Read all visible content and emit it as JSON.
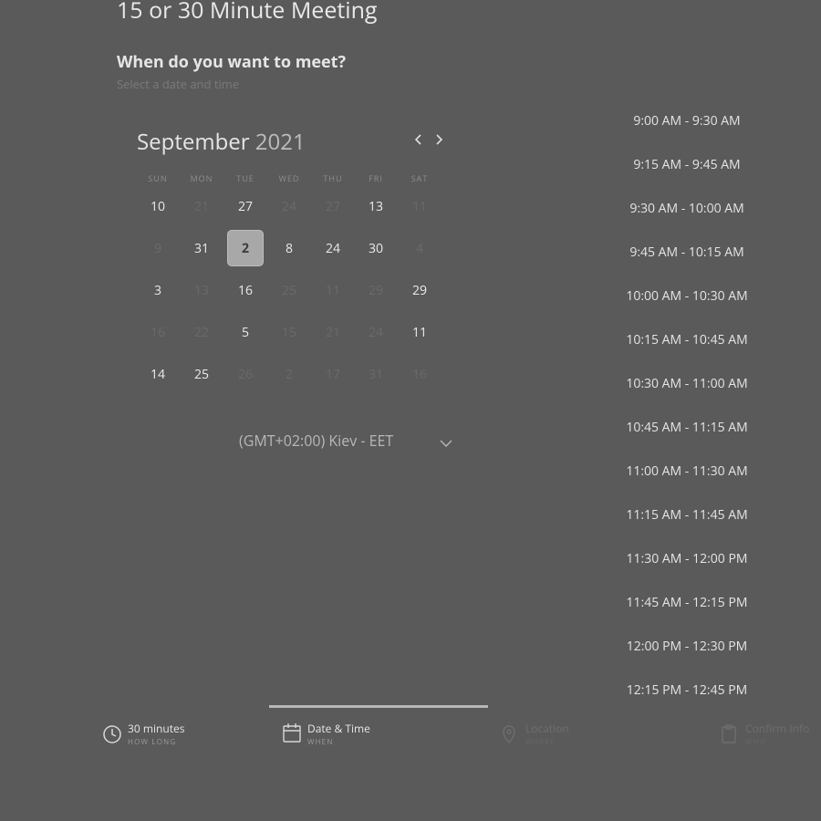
{
  "header": {
    "title": "15 or 30 Minute Meeting",
    "subtitle": "When do you want to meet?",
    "hint": "Select a date and time"
  },
  "calendar": {
    "month": "September",
    "year": "2021",
    "weekdays": [
      "SUN",
      "MON",
      "TUE",
      "WED",
      "THU",
      "FRI",
      "SAT"
    ],
    "rows": [
      [
        {
          "d": "10",
          "dis": false
        },
        {
          "d": "21",
          "dis": true
        },
        {
          "d": "27",
          "dis": false
        },
        {
          "d": "24",
          "dis": true
        },
        {
          "d": "27",
          "dis": true
        },
        {
          "d": "13",
          "dis": false
        },
        {
          "d": "11",
          "dis": true
        }
      ],
      [
        {
          "d": "9",
          "dis": true
        },
        {
          "d": "31",
          "dis": false
        },
        {
          "d": "2",
          "dis": false,
          "sel": true
        },
        {
          "d": "8",
          "dis": false
        },
        {
          "d": "24",
          "dis": false
        },
        {
          "d": "30",
          "dis": false
        },
        {
          "d": "4",
          "dis": true
        }
      ],
      [
        {
          "d": "3",
          "dis": false
        },
        {
          "d": "13",
          "dis": true
        },
        {
          "d": "16",
          "dis": false
        },
        {
          "d": "25",
          "dis": true
        },
        {
          "d": "11",
          "dis": true
        },
        {
          "d": "29",
          "dis": true
        },
        {
          "d": "29",
          "dis": false
        }
      ],
      [
        {
          "d": "16",
          "dis": true
        },
        {
          "d": "22",
          "dis": true
        },
        {
          "d": "5",
          "dis": false
        },
        {
          "d": "15",
          "dis": true
        },
        {
          "d": "21",
          "dis": true
        },
        {
          "d": "24",
          "dis": true
        },
        {
          "d": "11",
          "dis": false
        }
      ],
      [
        {
          "d": "14",
          "dis": false
        },
        {
          "d": "25",
          "dis": false
        },
        {
          "d": "26",
          "dis": true
        },
        {
          "d": "2",
          "dis": true
        },
        {
          "d": "17",
          "dis": true
        },
        {
          "d": "31",
          "dis": true
        },
        {
          "d": "16",
          "dis": true
        }
      ]
    ]
  },
  "timezone": "(GMT+02:00) Kiev - EET",
  "slots": [
    "9:00 AM - 9:30 AM",
    "9:15 AM - 9:45 AM",
    "9:30 AM - 10:00 AM",
    "9:45 AM - 10:15 AM",
    "10:00 AM - 10:30 AM",
    "10:15 AM - 10:45 AM",
    "10:30 AM - 11:00 AM",
    "10:45 AM - 11:15 AM",
    "11:00 AM - 11:30 AM",
    "11:15 AM - 11:45 AM",
    "11:30 AM - 12:00 PM",
    "11:45 AM - 12:15 PM",
    "12:00 PM - 12:30 PM",
    "12:15 PM - 12:45 PM"
  ],
  "steps": {
    "duration": {
      "label": "30 minutes",
      "sub": "HOW LONG",
      "icon": "clock-icon"
    },
    "datetime": {
      "label": "Date & Time",
      "sub": "WHEN",
      "icon": "calendar-icon"
    },
    "location": {
      "label": "Location",
      "sub": "WHERE",
      "icon": "location-pin-icon"
    },
    "confirm": {
      "label": "Confirm Info",
      "sub": "WHO",
      "icon": "clipboard-icon"
    }
  }
}
